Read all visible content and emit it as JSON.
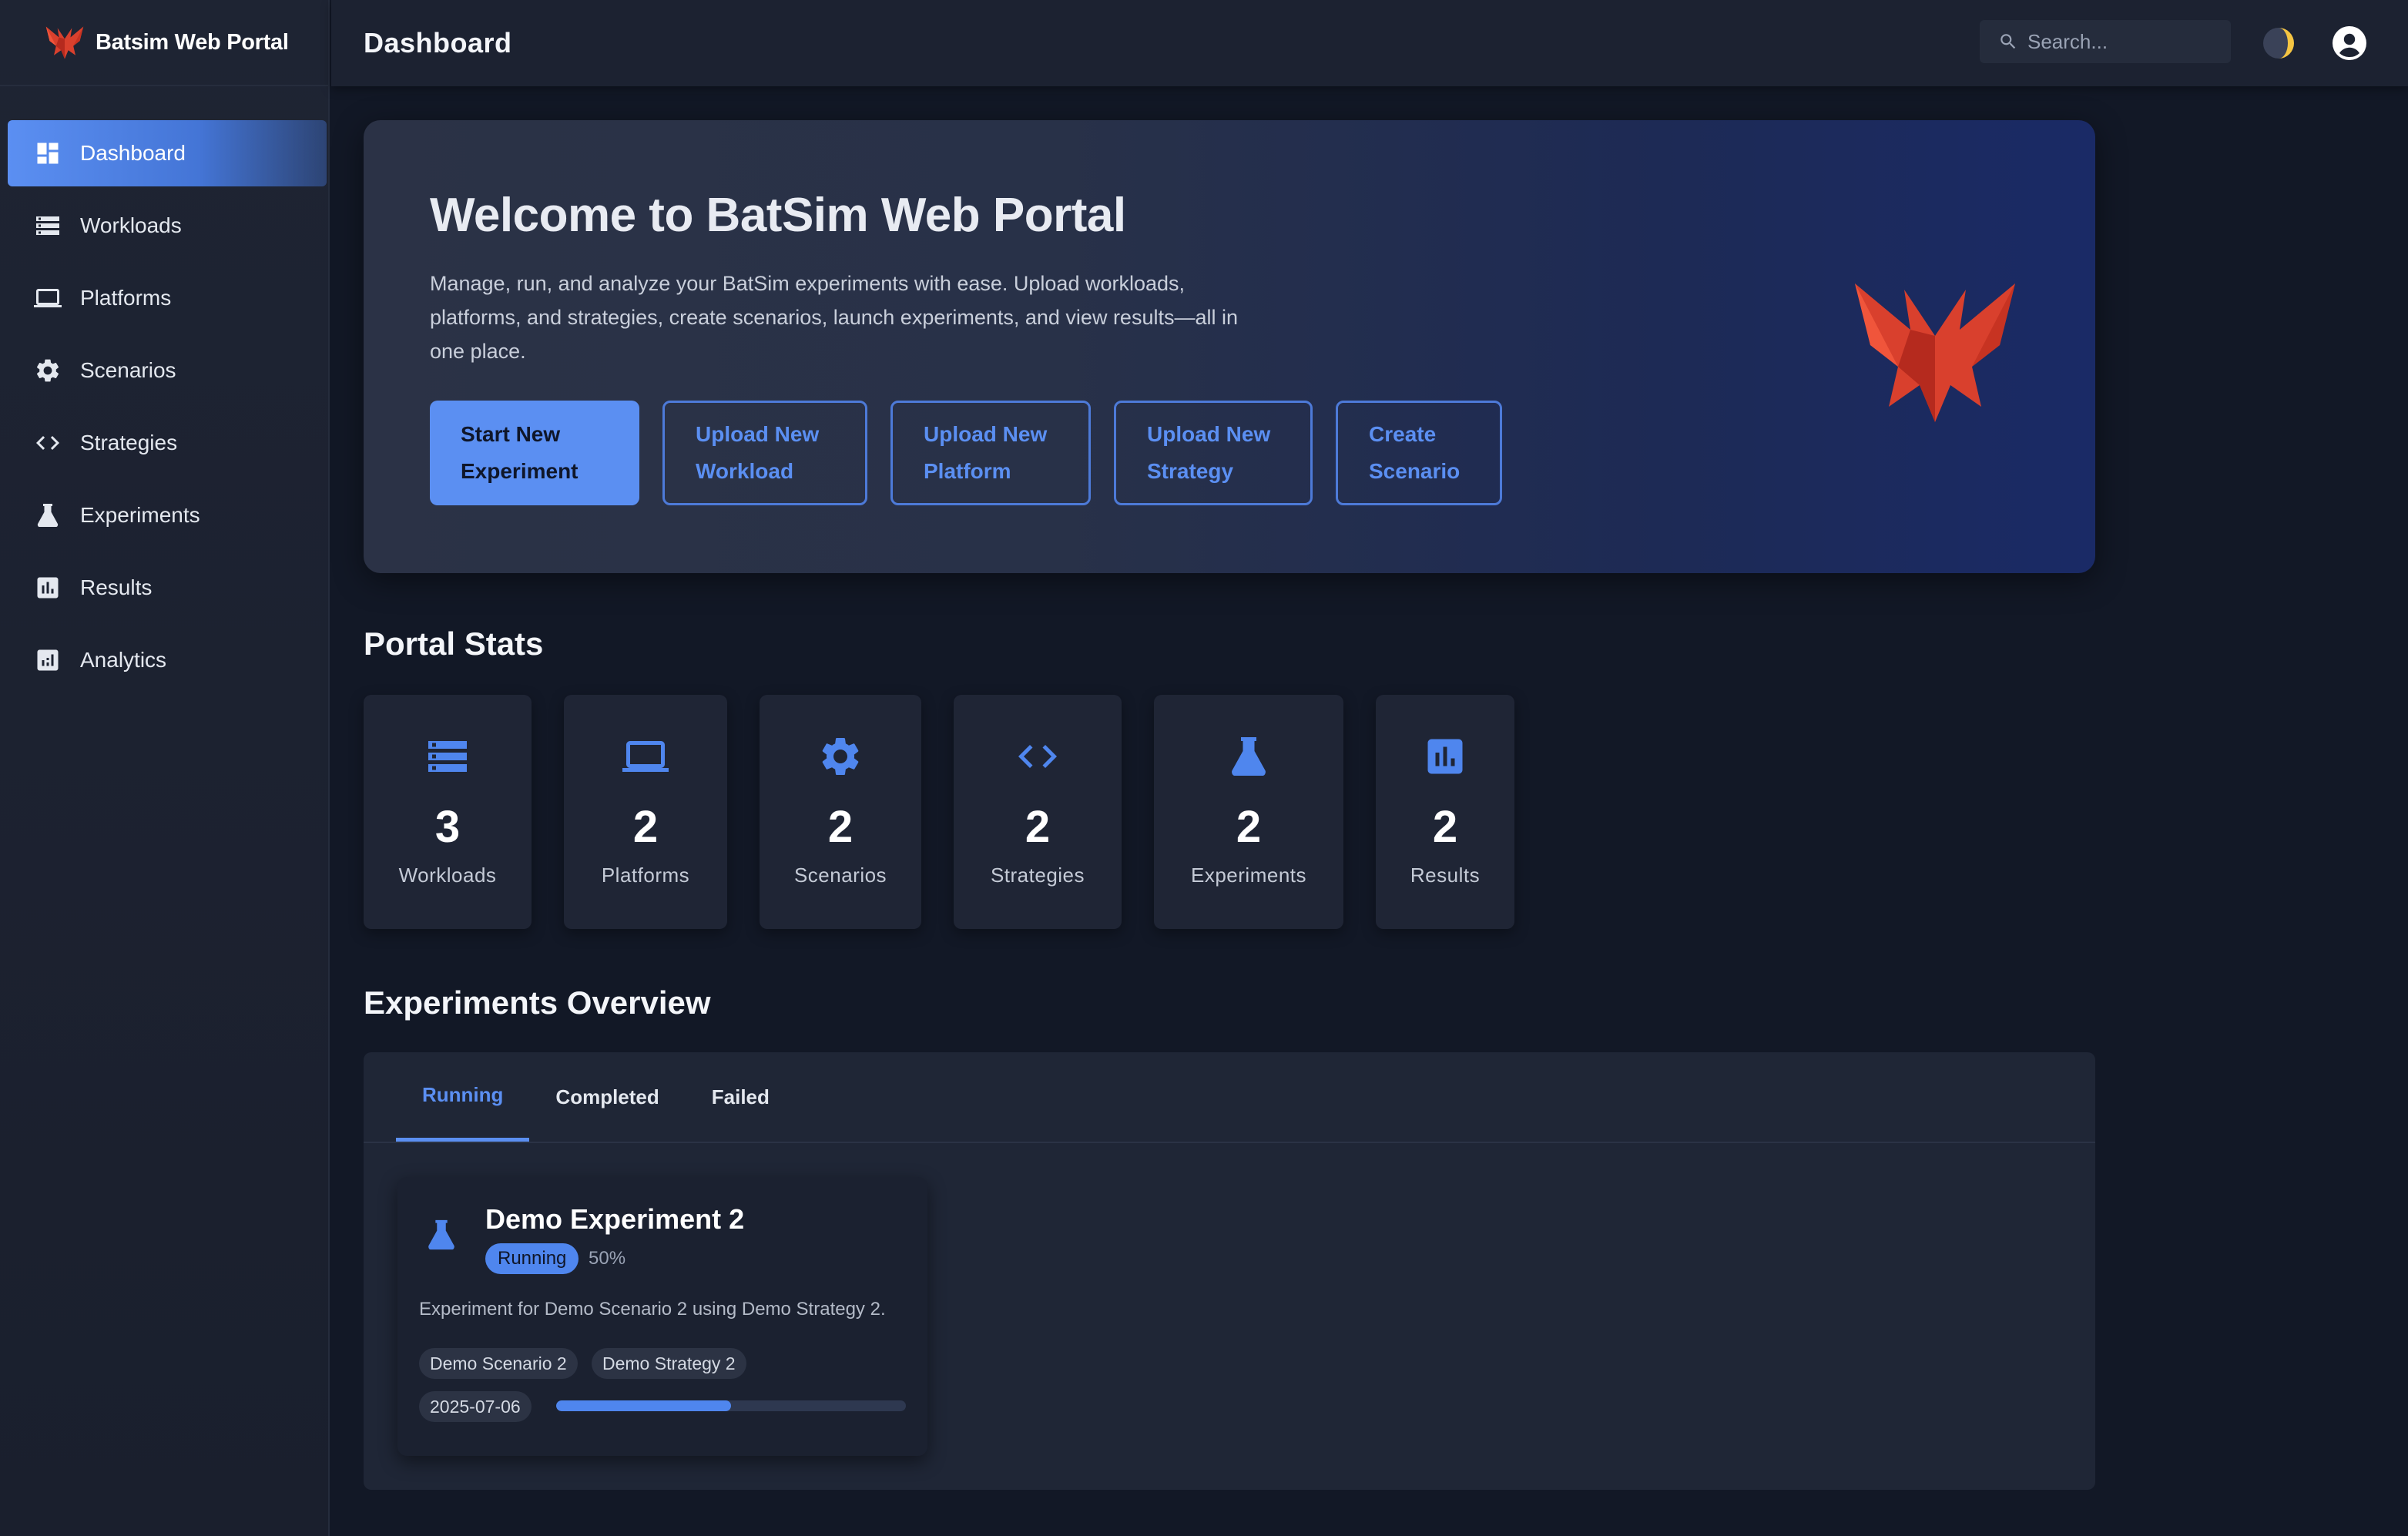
{
  "app": {
    "title": "Batsim Web Portal"
  },
  "sidebar": {
    "items": [
      {
        "label": "Dashboard",
        "icon": "dashboard-icon",
        "active": true
      },
      {
        "label": "Workloads",
        "icon": "server-stack-icon"
      },
      {
        "label": "Platforms",
        "icon": "laptop-icon"
      },
      {
        "label": "Scenarios",
        "icon": "gear-icon"
      },
      {
        "label": "Strategies",
        "icon": "code-icon"
      },
      {
        "label": "Experiments",
        "icon": "flask-icon"
      },
      {
        "label": "Results",
        "icon": "bar-chart-icon"
      },
      {
        "label": "Analytics",
        "icon": "analytics-icon"
      }
    ]
  },
  "header": {
    "title": "Dashboard",
    "search_placeholder": "Search..."
  },
  "hero": {
    "title": "Welcome to BatSim Web Portal",
    "description": "Manage, run, and analyze your BatSim experiments with ease. Upload workloads, platforms, and strategies, create scenarios, launch experiments, and view results—all in one place.",
    "buttons": {
      "start": "Start New\nExperiment",
      "workload": "Upload New\nWorkload",
      "platform": "Upload New\nPlatform",
      "strategy": "Upload New\nStrategy",
      "scenario": "Create\nScenario"
    }
  },
  "stats": {
    "title": "Portal Stats",
    "items": [
      {
        "label": "Workloads",
        "value": "3",
        "icon": "server-stack-icon"
      },
      {
        "label": "Platforms",
        "value": "2",
        "icon": "laptop-icon"
      },
      {
        "label": "Scenarios",
        "value": "2",
        "icon": "gear-icon"
      },
      {
        "label": "Strategies",
        "value": "2",
        "icon": "code-icon"
      },
      {
        "label": "Experiments",
        "value": "2",
        "icon": "flask-icon"
      },
      {
        "label": "Results",
        "value": "2",
        "icon": "bar-chart-icon"
      }
    ]
  },
  "experiments": {
    "title": "Experiments Overview",
    "tabs": [
      "Running",
      "Completed",
      "Failed"
    ],
    "active_tab": "Running",
    "card": {
      "name": "Demo Experiment 2",
      "status": "Running",
      "progress_label": "50%",
      "progress": 0.5,
      "description": "Experiment for Demo Scenario 2 using Demo Strategy 2.",
      "scenario": "Demo Scenario 2",
      "strategy": "Demo Strategy 2",
      "date": "2025-07-06"
    }
  },
  "colors": {
    "accent": "#5b8ff2",
    "background": "#121826",
    "surface": "#1f2535",
    "brand_red": "#d23a2a"
  }
}
